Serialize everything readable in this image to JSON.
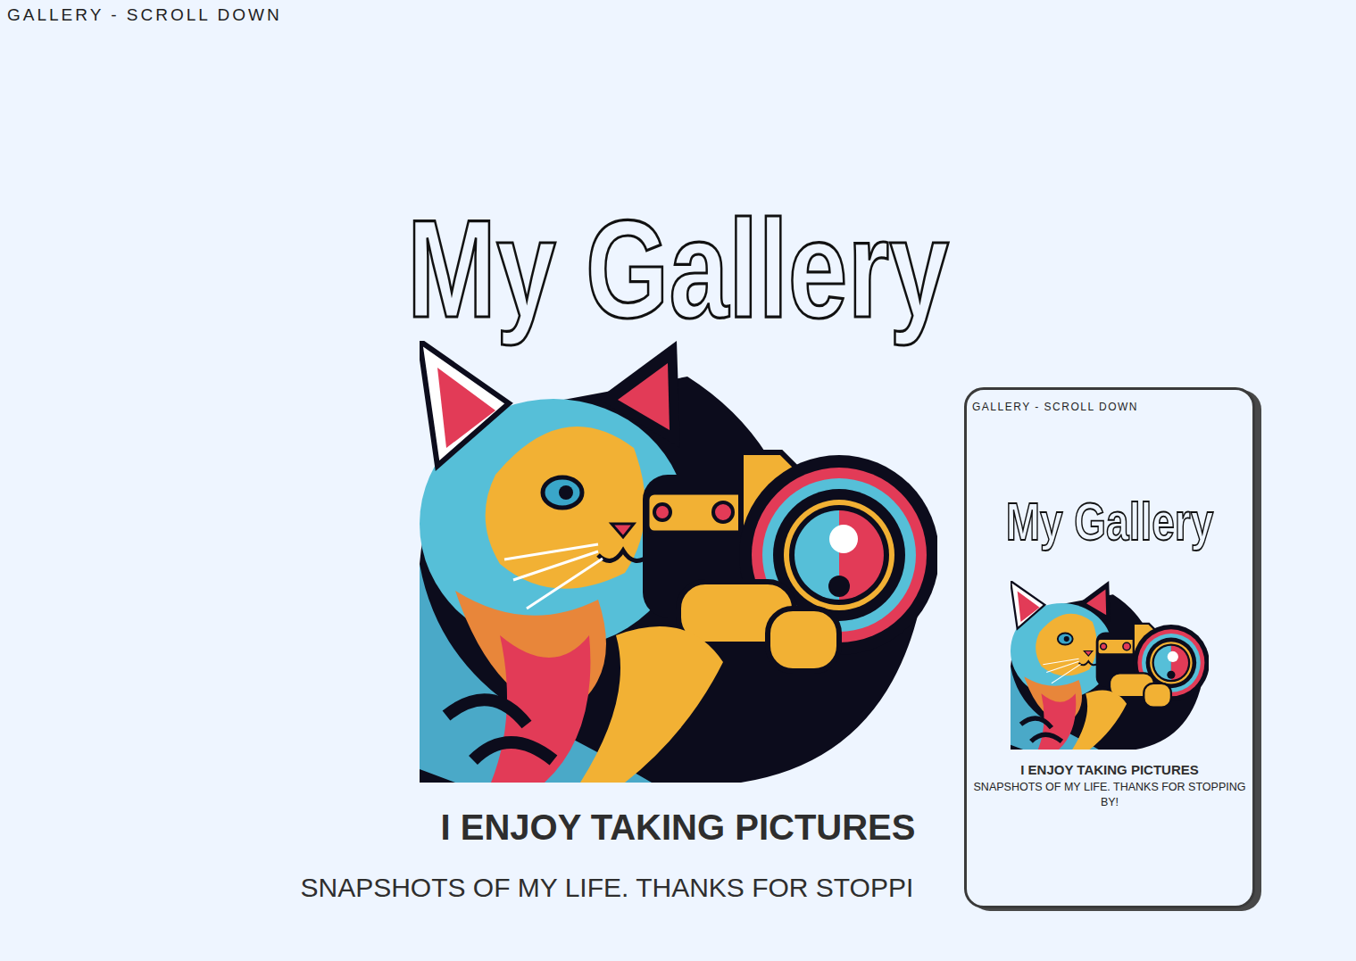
{
  "header": {
    "title": "GALLERY - SCROLL DOWN"
  },
  "hero": {
    "title": "My Gallery",
    "heading": "I ENJOY TAKING PICTURES",
    "subtitle": "SNAPSHOTS OF MY LIFE. THANKS FOR STOPPI"
  },
  "phone_preview": {
    "header": "GALLERY - SCROLL DOWN",
    "title": "My Gallery",
    "heading": "I ENJOY TAKING PICTURES",
    "subtitle": "SNAPSHOTS OF MY LIFE. THANKS FOR STOPPING BY!"
  }
}
